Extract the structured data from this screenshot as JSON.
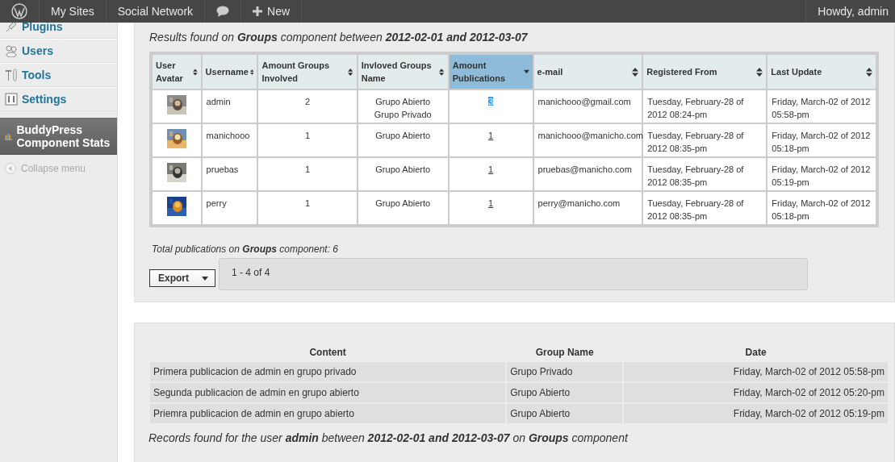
{
  "admin_bar": {
    "items": [
      {
        "kind": "logo"
      },
      {
        "kind": "text",
        "label": "My Sites"
      },
      {
        "kind": "text",
        "label": "Social Network"
      },
      {
        "kind": "comments"
      },
      {
        "kind": "new",
        "label": "New"
      }
    ],
    "account": "Howdy, admin"
  },
  "sidebar": {
    "items": [
      {
        "kind": "plugins",
        "label": "Plugins",
        "selected": false
      },
      {
        "kind": "users",
        "label": "Users",
        "selected": false
      },
      {
        "kind": "tools",
        "label": "Tools",
        "selected": false
      },
      {
        "kind": "settings",
        "label": "Settings",
        "selected": false
      },
      {
        "kind": "stats",
        "label": "BuddyPress Component Stats",
        "selected": true
      }
    ],
    "collapse": "Collapse menu"
  },
  "results": {
    "title": "Results found on **Groups** component between **2012-02-01 and 2012-03-07**",
    "table": {
      "columns": [
        {
          "label": "User Avatar",
          "sorted": false,
          "selected": false
        },
        {
          "label": "Username",
          "sorted": false,
          "selected": false
        },
        {
          "label": "Amount Groups Involved",
          "sorted": false,
          "selected": false
        },
        {
          "label": "Invloved Groups Name",
          "sorted": false,
          "selected": false
        },
        {
          "label": "Amount Publications",
          "sorted": true,
          "selected": true
        },
        {
          "label": "e-mail",
          "sorted": false,
          "selected": false
        },
        {
          "label": "Registered From",
          "sorted": false,
          "selected": false
        },
        {
          "label": "Last Update",
          "sorted": false,
          "selected": false
        }
      ],
      "rows": [
        {
          "avatar": {
            "kind": "person"
          },
          "username": "admin",
          "amount_groups": "2",
          "groups": [
            "Grupo Abierto",
            "Grupo Privado"
          ],
          "publications": "3",
          "publications_highlighted": true,
          "email": "manichooo@gmail.com",
          "registered": "Tuesday, February-28 of 2012 08:24-pm",
          "last_update": "Friday, March-02 of 2012 05:58-pm"
        },
        {
          "avatar": {
            "kind": "tower"
          },
          "username": "manichooo",
          "amount_groups": "1",
          "groups": [
            "Grupo Abierto"
          ],
          "publications": "1",
          "publications_highlighted": false,
          "email": "manichooo@manicho.com",
          "registered": "Tuesday, February-28 of 2012 08:35-pm",
          "last_update": "Friday, March-02 of 2012 05:18-pm"
        },
        {
          "avatar": {
            "kind": "animal"
          },
          "username": "pruebas",
          "amount_groups": "1",
          "groups": [
            "Grupo Abierto"
          ],
          "publications": "1",
          "publications_highlighted": false,
          "email": "pruebas@manicho.com",
          "registered": "Tuesday, February-28 of 2012 08:35-pm",
          "last_update": "Friday, March-02 of 2012 05:19-pm"
        },
        {
          "avatar": {
            "kind": "jellyfish"
          },
          "username": "perry",
          "amount_groups": "1",
          "groups": [
            "Grupo Abierto"
          ],
          "publications": "1",
          "publications_highlighted": false,
          "email": "perry@manicho.com",
          "registered": "Tuesday, February-28 of 2012 08:35-pm",
          "last_update": "Friday, March-02 of 2012 05:18-pm"
        }
      ]
    },
    "total": "Total publications on **Groups** component: 6",
    "export_button": "Export",
    "pager": "1 - 4 of 4"
  },
  "records": {
    "table": {
      "columns": [
        "Content",
        "Group Name",
        "Date"
      ],
      "rows": [
        [
          "Primera publicacion de admin en grupo privado",
          "Grupo Privado",
          "Friday, March-02 of 2012 05:58-pm"
        ],
        [
          "Segunda publicacion de admin en grupo abierto",
          "Grupo Abierto",
          "Friday, March-02 of 2012 05:20-pm"
        ],
        [
          "Priemra publicacion de admin en grupo abierto",
          "Grupo Abierto",
          "Friday, March-02 of 2012 05:19-pm"
        ]
      ]
    },
    "caption": "Records found for the user **admin** between **2012-02-01 and 2012-03-07** on **Groups** component"
  }
}
